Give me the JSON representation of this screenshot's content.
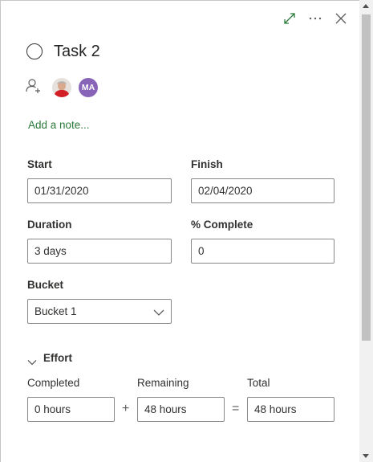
{
  "task": {
    "title": "Task 2"
  },
  "avatars": {
    "second_initials": "MA",
    "second_color": "#8764b8"
  },
  "note": {
    "add_note_label": "Add a note..."
  },
  "dates": {
    "start_label": "Start",
    "start_value": "01/31/2020",
    "finish_label": "Finish",
    "finish_value": "02/04/2020"
  },
  "progress": {
    "duration_label": "Duration",
    "duration_value": "3 days",
    "complete_label": "% Complete",
    "complete_value": "0"
  },
  "bucket": {
    "label": "Bucket",
    "selected": "Bucket 1"
  },
  "effort": {
    "section_label": "Effort",
    "completed_label": "Completed",
    "completed_value": "0 hours",
    "remaining_label": "Remaining",
    "remaining_value": "48 hours",
    "total_label": "Total",
    "total_value": "48 hours",
    "plus_sign": "+",
    "equals_sign": "="
  },
  "icons": {
    "expand": "expand-icon",
    "more": "more-icon",
    "close": "close-icon",
    "status": "task-status-circle",
    "assign": "assign-person-icon",
    "dropdown": "chevron-down-icon",
    "collapse": "chevron-down-icon"
  },
  "colors": {
    "accent_green": "#2b7a3b",
    "avatar_purple": "#8764b8"
  }
}
